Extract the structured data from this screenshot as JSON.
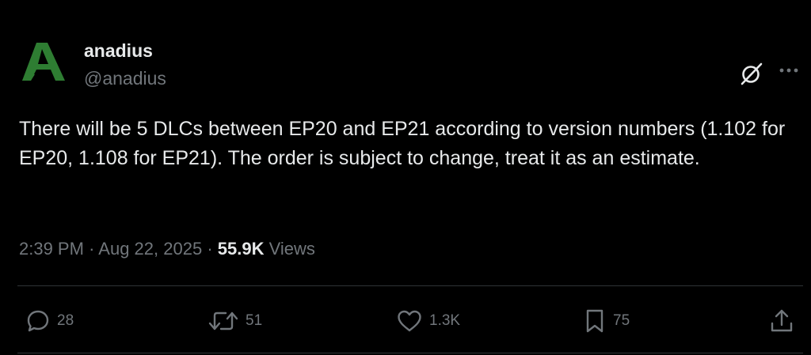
{
  "author": {
    "display_name": "anadius",
    "handle": "@anadius",
    "avatar_letter": "A",
    "avatar_color": "#2e7d32"
  },
  "tweet": {
    "text": "There will be 5 DLCs between EP20 and EP21 according to version numbers (1.102 for EP20, 1.108 for EP21). The order is subject to change, treat it as an estimate."
  },
  "meta": {
    "time": "2:39 PM",
    "separator": "·",
    "date": "Aug 22, 2025",
    "views_count": "55.9K",
    "views_label": "Views"
  },
  "actions": {
    "reply_count": "28",
    "repost_count": "51",
    "like_count": "1.3K",
    "bookmark_count": "75"
  },
  "icons": {
    "header": [
      "grok-icon",
      "more-icon"
    ],
    "actions": [
      "reply-icon",
      "repost-icon",
      "like-icon",
      "bookmark-icon",
      "share-icon"
    ]
  },
  "colors": {
    "background": "#000000",
    "text_primary": "#e7e9ea",
    "text_secondary": "#71767b",
    "divider": "#2f3336"
  }
}
